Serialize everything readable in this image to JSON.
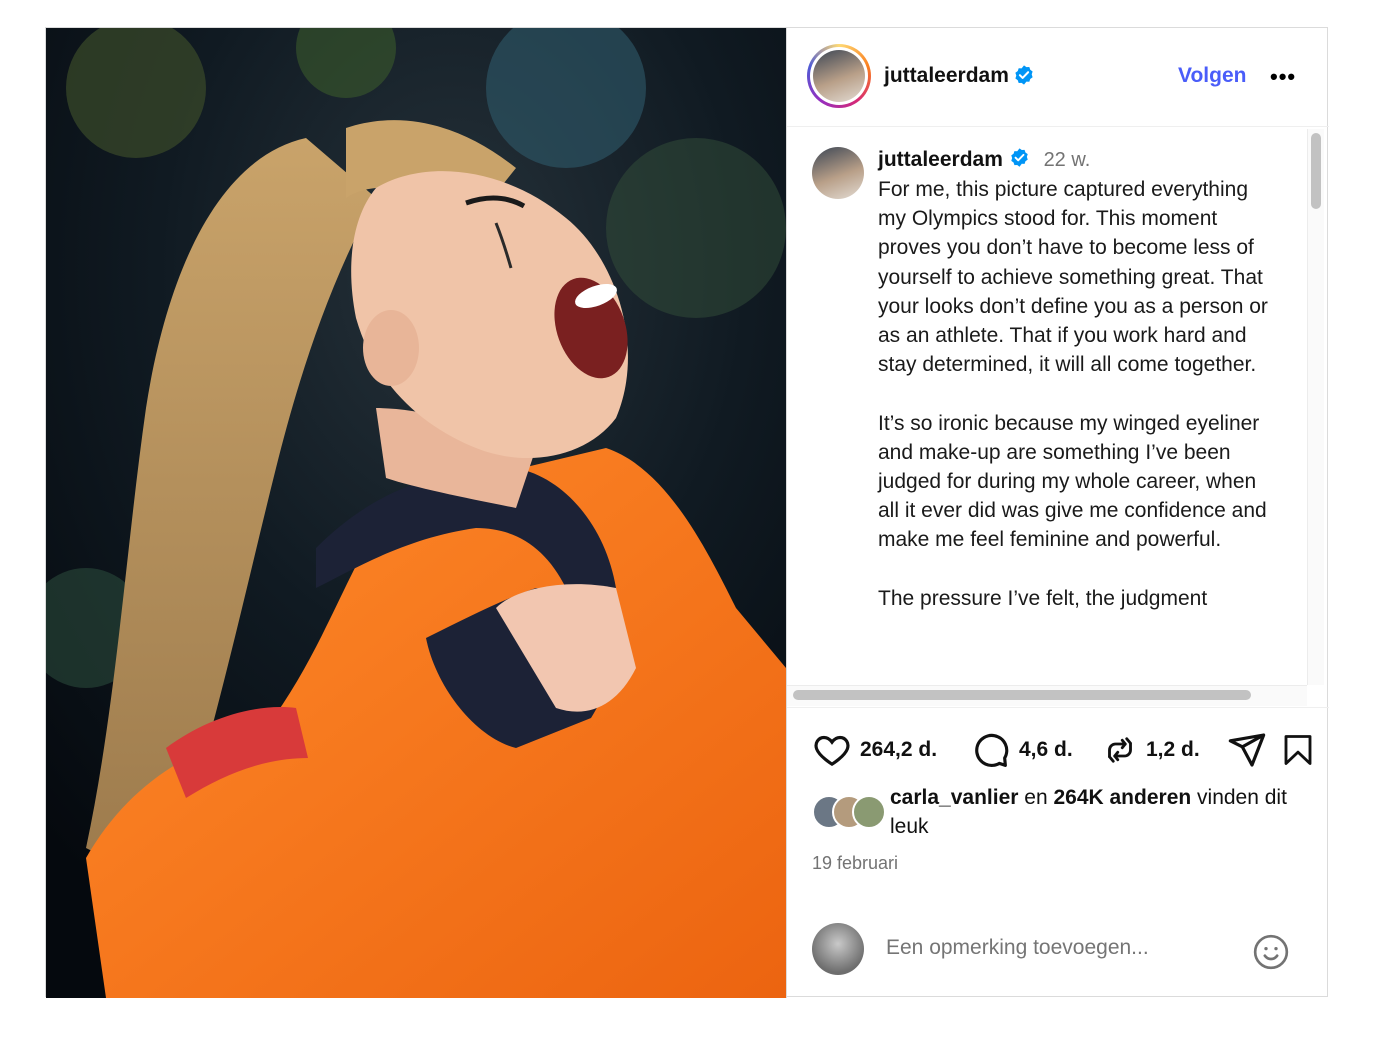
{
  "post": {
    "username": "juttaleerdam",
    "follow_label": "Volgen",
    "more_label": "•••",
    "caption": {
      "username": "juttaleerdam",
      "time": "22 w.",
      "text": "For me, this picture captured everything my Olympics stood for. This moment proves you don’t have to become less of yourself to achieve something great. That your looks don’t define you as a person or as an athlete. That if you work hard and stay determined, it will all come together.\n\nIt’s so ironic because my winged eyeliner and make-up are something I’ve been judged for during my whole career, when all it ever did was give me confidence and make me feel feminine and powerful.\n\nThe pressure I’ve felt, the judgment"
    },
    "actions": {
      "likes": "264,2 d.",
      "comments": "4,6 d.",
      "reposts": "1,2 d."
    },
    "liked_by": {
      "user": "carla_vanlier",
      "connector": " en ",
      "others": "264K anderen",
      "suffix": " vinden dit leuk"
    },
    "date": "19 februari",
    "comment_placeholder": "Een opmerking toevoegen...",
    "icons": [
      "verified-badge-icon",
      "heart-icon",
      "comment-icon",
      "repost-icon",
      "share-icon",
      "bookmark-icon",
      "emoji-icon"
    ],
    "colors": {
      "link_blue": "#4a5df9",
      "verified": "#0095f6",
      "muted": "#737373"
    }
  }
}
